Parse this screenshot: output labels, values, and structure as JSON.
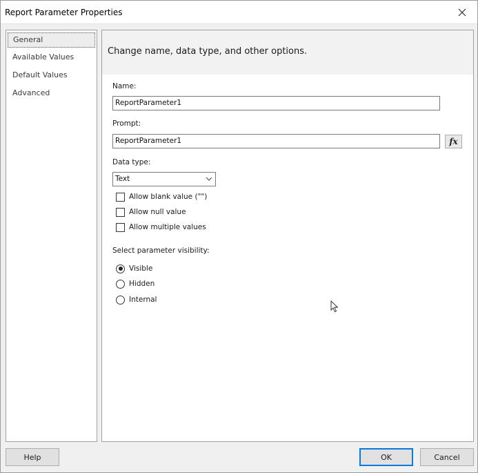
{
  "window": {
    "title": "Report Parameter Properties"
  },
  "nav": {
    "items": [
      {
        "label": "General",
        "selected": true
      },
      {
        "label": "Available Values",
        "selected": false
      },
      {
        "label": "Default Values",
        "selected": false
      },
      {
        "label": "Advanced",
        "selected": false
      }
    ]
  },
  "content": {
    "header": "Change name, data type, and other options.",
    "name_label": "Name:",
    "name_value": "ReportParameter1",
    "prompt_label": "Prompt:",
    "prompt_value": "ReportParameter1",
    "fx_label": "fx",
    "datatype_label": "Data type:",
    "datatype_value": "Text",
    "checkboxes": [
      {
        "label": "Allow blank value (\"\")",
        "checked": false
      },
      {
        "label": "Allow null value",
        "checked": false
      },
      {
        "label": "Allow multiple values",
        "checked": false
      }
    ],
    "visibility_label": "Select parameter visibility:",
    "visibility_options": [
      {
        "label": "Visible",
        "checked": true
      },
      {
        "label": "Hidden",
        "checked": false
      },
      {
        "label": "Internal",
        "checked": false
      }
    ]
  },
  "footer": {
    "help_label": "Help",
    "ok_label": "OK",
    "cancel_label": "Cancel"
  },
  "colors": {
    "accent": "#0078d7",
    "dialog_bg": "#f0f0f0"
  }
}
